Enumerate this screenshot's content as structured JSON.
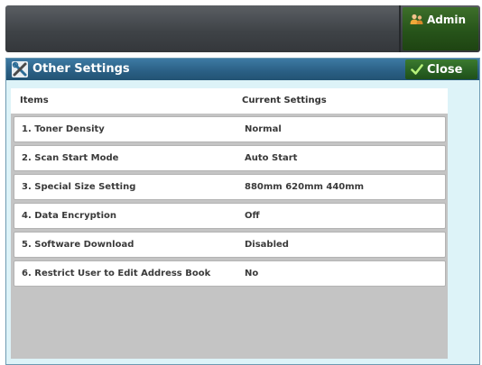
{
  "topbar": {
    "admin_label": "Admin"
  },
  "dialog": {
    "title": "Other Settings",
    "close_label": "Close",
    "columns": {
      "items": "Items",
      "current_settings": "Current Settings"
    },
    "rows": [
      {
        "item": "1. Toner Density",
        "setting": "Normal"
      },
      {
        "item": "2. Scan Start Mode",
        "setting": "Auto Start"
      },
      {
        "item": "3. Special Size Setting",
        "setting": "880mm 620mm 440mm"
      },
      {
        "item": "4. Data Encryption",
        "setting": "Off"
      },
      {
        "item": "5. Software Download",
        "setting": "Disabled"
      },
      {
        "item": "6. Restrict User to Edit Address Book",
        "setting": "No"
      }
    ]
  },
  "icons": {
    "admin": "admin-user-icon",
    "title": "tools-icon",
    "close": "checkmark-icon"
  },
  "colors": {
    "titlebar": "#2a5f84",
    "dialog_bg": "#ddf3f8",
    "admin_button": "#27541a",
    "close_button": "#286022"
  }
}
